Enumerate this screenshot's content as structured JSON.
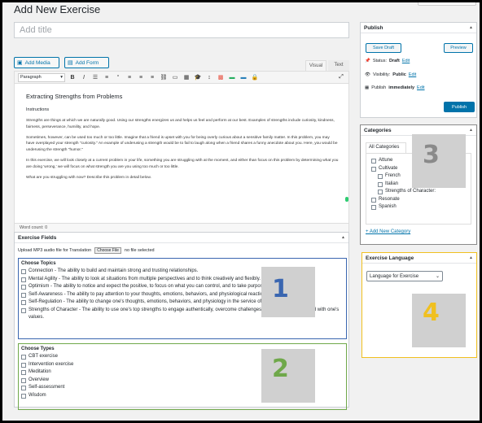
{
  "page_title": "Add New Exercise",
  "title_placeholder": "Add title",
  "media": {
    "add_media": "Add Media",
    "add_form": "Add Form"
  },
  "editor_tabs": {
    "visual": "Visual",
    "text": "Text"
  },
  "toolbar": {
    "format": "Paragraph",
    "icons": [
      "bold-icon",
      "italic-icon",
      "bullet-list-icon",
      "numbered-list-icon",
      "blockquote-icon",
      "align-left-icon",
      "align-center-icon",
      "align-right-icon",
      "link-icon",
      "toolbar-toggle-icon",
      "table-icon",
      "graduation-cap-icon",
      "line-height-icon",
      "color-palette-icon",
      "highlight-icon",
      "strikethrough-icon",
      "lock-icon",
      "fullscreen-icon"
    ],
    "glyphs": [
      "B",
      "I",
      "☰",
      "≡",
      "“",
      "≡",
      "≡",
      "≡",
      "⛓",
      "▭",
      "▦",
      "🎓",
      "↕",
      "▩",
      "▬",
      "▬",
      "🔒",
      "⤢"
    ]
  },
  "content": {
    "heading": "Extracting Strengths from Problems",
    "subheading": "Instructions",
    "paragraphs": [
      "Strengths are things at which we are naturally good. Using our strengths energizes us and helps us feel and perform at our best. Examples of strengths include curiosity, kindness, fairness, perseverance, humility, and hope.",
      "Sometimes, however, can be used too much or too little. Imagine that a friend is upset with you for being overly curious about a sensitive family matter. In this problem, you may have overplayed your strength \"curiosity.\" An example of underusing a strength would be to fail to laugh along when a friend shares a funny anecdote about you. Here, you would be underusing the strength \"humor.\"",
      "In this exercise, we will look closely at a current problem in your life, something you are struggling with at the moment, and either than focus on this problem by determining what you are doing 'wrong,' we will focus on what strength you are you using too much or too little.",
      "What are you struggling with now? Describe this problem in detail below."
    ]
  },
  "word_count": "Word count: 0",
  "exercise_fields": {
    "title": "Exercise Fields",
    "upload_label": "Upload MP3 audio file for Translation",
    "choose_file": "Choose File",
    "no_file": "no file selected"
  },
  "topics": {
    "title": "Choose Topics",
    "items": [
      "Connection - The ability to build and maintain strong and trusting relationships.",
      "Mental Agility - The ability to look at situations from multiple perspectives and to think creatively and flexibly.",
      "Optimism - The ability to notice and expect the positive, to focus on what you can control, and to take purposeful action.",
      "Self-Awareness - The ability to pay attention to your thoughts, emotions, behaviors, and physiological reactions.",
      "Self-Regulation - The ability to change one's thoughts, emotions, behaviors, and physiology in the service of a desired outcome.",
      "Strengths of Character - The ability to use one's top strengths to engage authentically, overcome challenges, and create a life aligned with one's values."
    ]
  },
  "types": {
    "title": "Choose Types",
    "items": [
      "CBT exercise",
      "Intervention exercise",
      "Meditation",
      "Overview",
      "Self-assessment",
      "Wisdom"
    ]
  },
  "publish": {
    "title": "Publish",
    "save_draft": "Save Draft",
    "preview": "Preview",
    "status_label": "Status:",
    "status_value": "Draft",
    "visibility_label": "Visibility:",
    "visibility_value": "Public",
    "publish_label": "Publish",
    "publish_value": "immediately",
    "edit": "Edit",
    "publish_button": "Publish"
  },
  "categories": {
    "title": "Categories",
    "tab": "All Categories",
    "items": [
      {
        "label": "Attune",
        "level": 0
      },
      {
        "label": "Cultivate",
        "level": 0
      },
      {
        "label": "French",
        "level": 1
      },
      {
        "label": "Italian",
        "level": 1
      },
      {
        "label": "Strengths of Character:",
        "level": 1
      },
      {
        "label": "Resonate",
        "level": 0
      },
      {
        "label": "Spanish",
        "level": 0
      }
    ],
    "add_new": "+ Add New Category"
  },
  "exercise_language": {
    "title": "Exercise Language",
    "selected": "Language for Exercise"
  },
  "annotations": {
    "n1": "1",
    "n2": "2",
    "n3": "3",
    "n4": "4",
    "color1": "#3a66b0",
    "color2": "#6fa84a",
    "color3": "#8a8a8a",
    "color4": "#f0c020"
  }
}
